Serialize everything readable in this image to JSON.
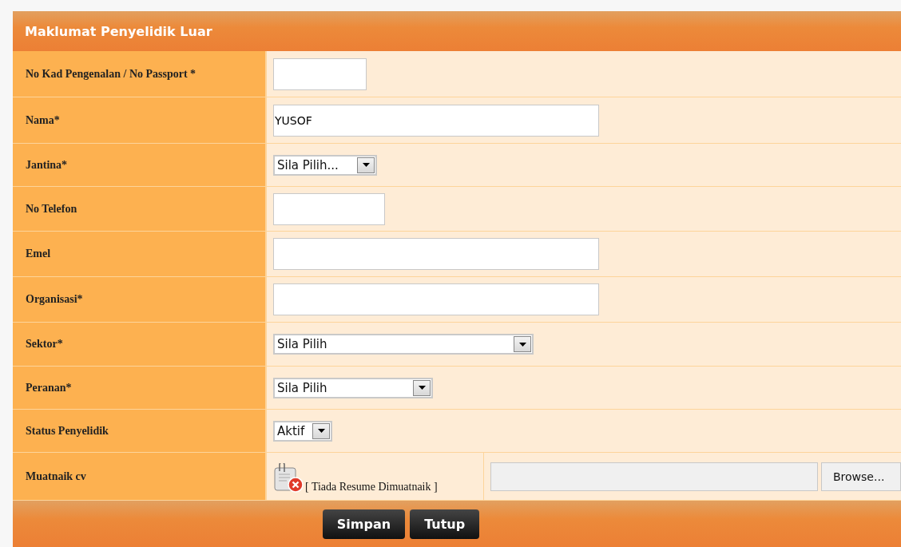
{
  "panel": {
    "title": "Maklumat Penyelidik Luar"
  },
  "rows": [
    {
      "label": "No Kad Pengenalan / No Passport *",
      "kind": "text",
      "value": ""
    },
    {
      "label": "Nama*",
      "kind": "text",
      "value": "YUSOF"
    },
    {
      "label": "Jantina*",
      "kind": "select",
      "value": "Sila Pilih..."
    },
    {
      "label": "No Telefon",
      "kind": "text",
      "value": ""
    },
    {
      "label": "Emel",
      "kind": "text",
      "value": ""
    },
    {
      "label": "Organisasi*",
      "kind": "text",
      "value": ""
    },
    {
      "label": "Sektor*",
      "kind": "select",
      "value": "Sila Pilih"
    },
    {
      "label": "Peranan*",
      "kind": "select",
      "value": "Sila Pilih"
    },
    {
      "label": "Status Penyelidik",
      "kind": "select",
      "value": "Aktif"
    },
    {
      "label": "Muatnaik cv",
      "kind": "file",
      "status": "[ Tiada Resume Dimuatnaik ]",
      "button": "Browse..."
    }
  ],
  "buttons": [
    "Simpan",
    "Tutup"
  ]
}
